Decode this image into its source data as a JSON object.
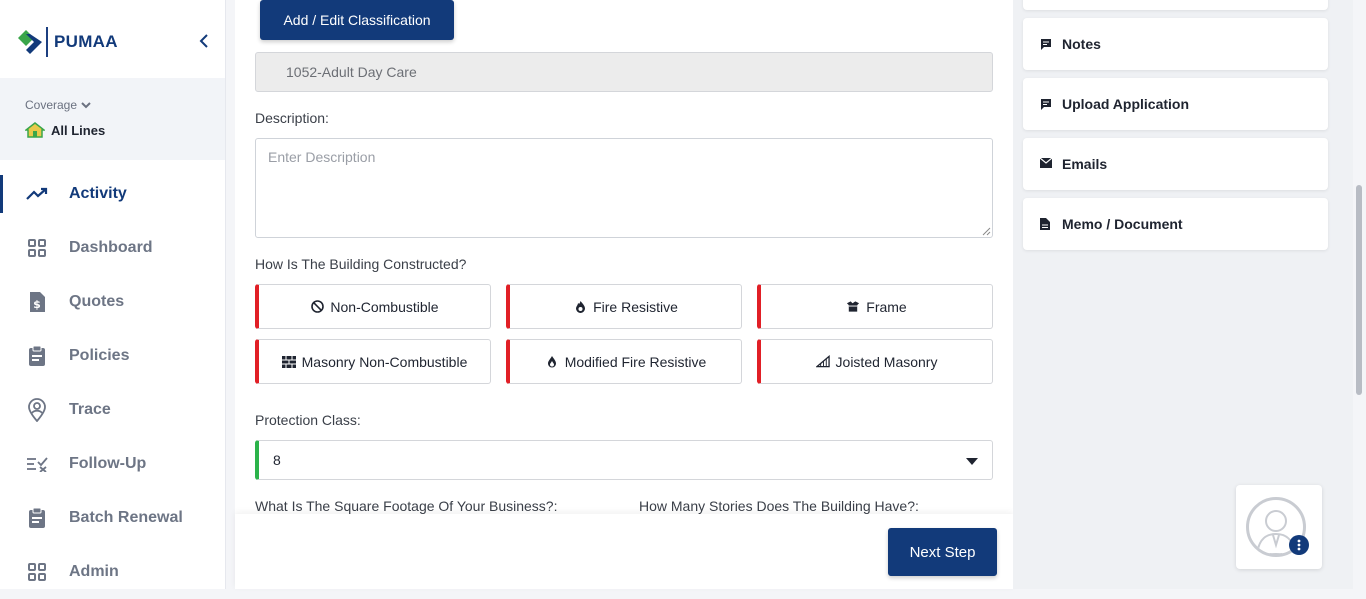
{
  "brand": {
    "name": "PUMAA"
  },
  "coverage": {
    "label": "Coverage",
    "value": "All Lines"
  },
  "nav": [
    {
      "label": "Activity",
      "icon": "trending-up-icon",
      "active": true
    },
    {
      "label": "Dashboard",
      "icon": "grid-icon"
    },
    {
      "label": "Quotes",
      "icon": "dollar-document-icon"
    },
    {
      "label": "Policies",
      "icon": "clipboard-icon"
    },
    {
      "label": "Trace",
      "icon": "location-person-icon"
    },
    {
      "label": "Follow-Up",
      "icon": "list-check-icon"
    },
    {
      "label": "Batch Renewal",
      "icon": "clipboard-icon"
    },
    {
      "label": "Admin",
      "icon": "grid-icon"
    }
  ],
  "main": {
    "add_classification_label": "Add / Edit Classification",
    "classification_value": "1052-Adult Day Care",
    "description_label": "Description:",
    "description_placeholder": "Enter Description",
    "construction_label": "How Is The Building Constructed?",
    "construction_types": [
      {
        "label": "Non-Combustible",
        "icon": "prohibited-icon"
      },
      {
        "label": "Fire Resistive",
        "icon": "fire-icon"
      },
      {
        "label": "Frame",
        "icon": "box-frame-icon"
      },
      {
        "label": "Masonry Non-Combustible",
        "icon": "brick-wall-icon"
      },
      {
        "label": "Modified Fire Resistive",
        "icon": "flame-icon"
      },
      {
        "label": "Joisted Masonry",
        "icon": "joist-icon"
      }
    ],
    "protection_class_label": "Protection Class:",
    "protection_class_value": "8",
    "square_footage_label": "What Is The Square Footage Of Your Business?:",
    "stories_label": "How Many Stories Does The Building Have?:",
    "next_step_label": "Next Step"
  },
  "right_panel": {
    "items": [
      {
        "label": "Notes",
        "icon": "comment-icon"
      },
      {
        "label": "Upload Application",
        "icon": "comment-icon"
      },
      {
        "label": "Emails",
        "icon": "envelope-icon"
      },
      {
        "label": "Memo / Document",
        "icon": "document-icon"
      }
    ]
  },
  "colors": {
    "primary": "#123a7a",
    "required": "#e11f26",
    "valid": "#2bb34a"
  }
}
